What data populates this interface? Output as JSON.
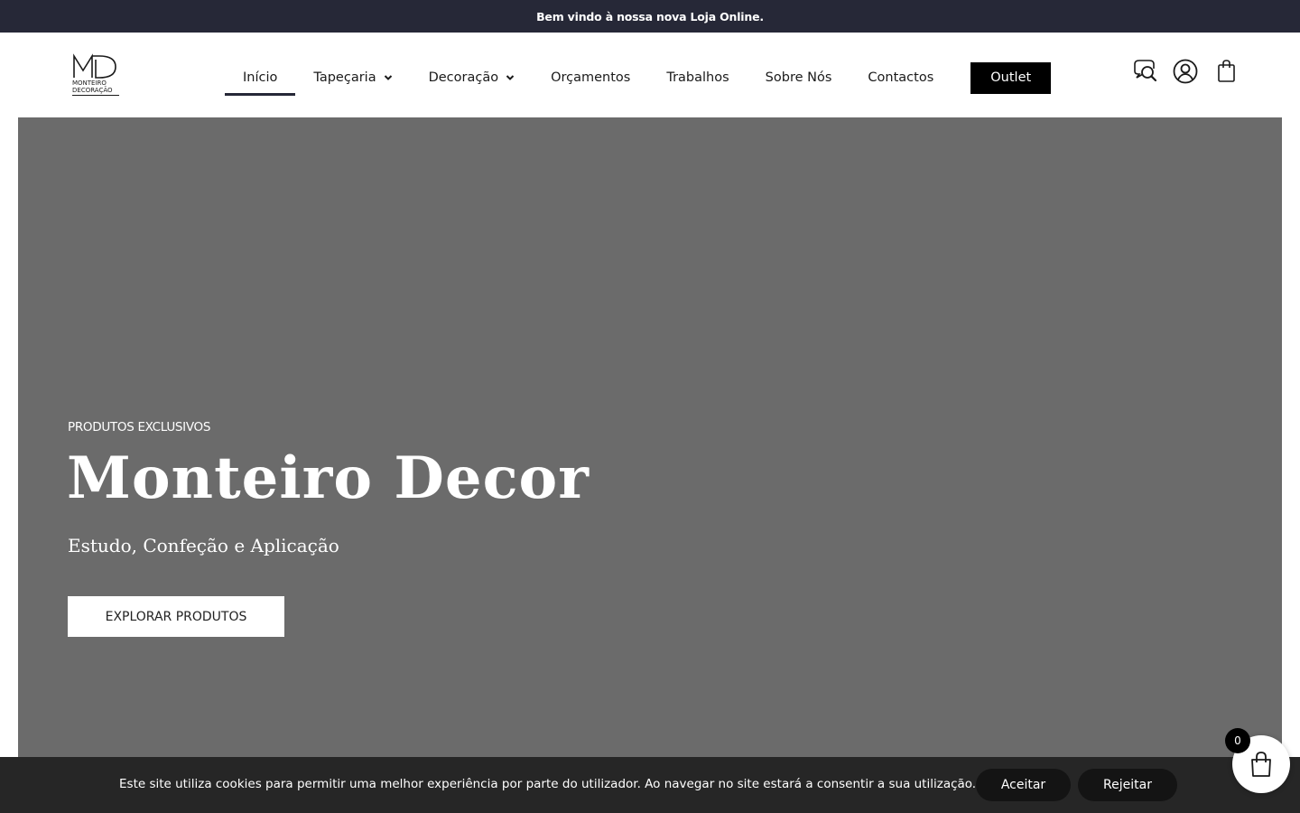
{
  "announcement": {
    "text": "Bem vindo à nossa nova Loja Online."
  },
  "logo": {
    "line1": "MONTEIRO",
    "line2": "DECORAÇÃO",
    "monogram": "MD"
  },
  "nav": {
    "items": [
      {
        "label": "Início",
        "active": true
      },
      {
        "label": "Tapeçaria",
        "has_dropdown": true
      },
      {
        "label": "Decoração",
        "has_dropdown": true
      },
      {
        "label": "Orçamentos"
      },
      {
        "label": "Trabalhos"
      },
      {
        "label": "Sobre Nós"
      },
      {
        "label": "Contactos"
      }
    ],
    "outlet_label": "Outlet"
  },
  "header_icons": {
    "search": "search-chat-icon",
    "account": "user-icon",
    "cart": "shopping-bag-icon"
  },
  "hero": {
    "kicker": "PRODUTOS EXCLUSIVOS",
    "title": "Monteiro Decor",
    "subtitle": "Estudo, Confeção e Aplicação",
    "cta_label": "EXPLORAR PRODUTOS",
    "background_color": "#6b6b6b"
  },
  "cookie_banner": {
    "text": "Este site utiliza cookies para permitir uma melhor experiência por parte do utilizador. Ao navegar no site estará a consentir a sua utilização.",
    "accept_label": "Aceitar",
    "reject_label": "Rejeitar"
  },
  "floating_cart": {
    "count": "0",
    "icon": "shopping-bag-icon"
  },
  "colors": {
    "topbar": "#262837",
    "active_underline": "#262837",
    "outlet_bg": "#000000",
    "cookie_bg": "#262626"
  }
}
